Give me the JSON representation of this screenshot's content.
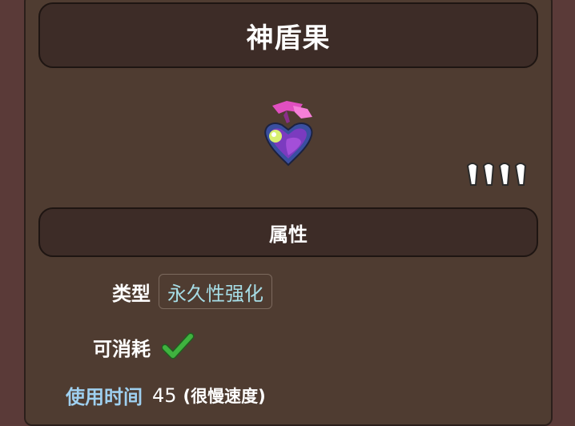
{
  "item": {
    "name": "神盾果",
    "sprite_icon": "life-fruit-heart-icon",
    "quality_icon": "rarity-pips-icon"
  },
  "section": {
    "title": "属性"
  },
  "properties": {
    "type_label": "类型",
    "type_value": "永久性强化",
    "consumable_label": "可消耗",
    "consumable_icon": "checkmark-icon",
    "use_time_label": "使用时间",
    "use_time_value": "45",
    "use_time_desc": "(很慢速度)"
  },
  "colors": {
    "background": "#5a3a38",
    "panel": "#4f3c31",
    "header_bar": "#3d2c27",
    "type_text": "#a6dde6",
    "use_time_label": "#9fd0f0",
    "check": "#3fb33f"
  }
}
